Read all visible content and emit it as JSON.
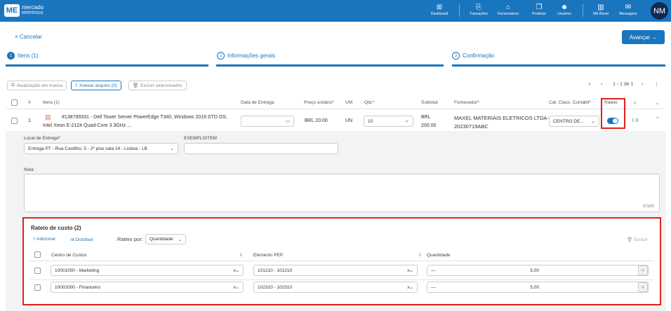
{
  "header": {
    "logo_mark": "ME",
    "logo_line1": "mercado",
    "logo_line2": "eletrônico",
    "nav": [
      {
        "label": "Dashboard",
        "icon": "grid-icon"
      },
      {
        "label": "Transações",
        "icon": "document-arrow-icon"
      },
      {
        "label": "Fornecedores",
        "icon": "store-icon"
      },
      {
        "label": "Produtos",
        "icon": "box-icon"
      },
      {
        "label": "Usuários",
        "icon": "users-icon"
      },
      {
        "label": "ME Boost",
        "icon": "chart-icon"
      },
      {
        "label": "Mensagens",
        "icon": "chat-icon"
      }
    ],
    "avatar": "NM"
  },
  "actions": {
    "cancel": "× Cancelar",
    "advance": "Avançar →"
  },
  "steps": [
    {
      "num": "1",
      "label": "Itens (1)"
    },
    {
      "num": "2",
      "label": "Informações gerais"
    },
    {
      "num": "3",
      "label": "Confirmação"
    }
  ],
  "toolbar": {
    "bulk_update": "Atualização em massa",
    "attach": "Anexar arquivo (0)",
    "delete_selected": "Excluir selecionados",
    "page_info": "1 - 1 de 1"
  },
  "table": {
    "headers": {
      "num": "#",
      "items": "Itens (1)",
      "delivery_date": "Data de Entrega",
      "unit_price": "Preço unitário*",
      "um": "UM",
      "qty": "Qtd.*",
      "subtotal": "Subtotal",
      "supplier": "Fornecedor*",
      "account_class": "Cat. Class. Contábil*",
      "rateio": "Rateio"
    },
    "row": {
      "num": "1",
      "description_line1": "#138799331 - Dell Tower Server PowerEdge T340, Windows 2019 STD OS,",
      "description_line2": "Intel Xeon E-2124 Quad-Core 3.3GHz ...",
      "price": "BRL 20.00",
      "um": "UN",
      "qty": "10",
      "subtotal_line1": "BRL",
      "subtotal_line2": "200.00",
      "supplier_line1": "MAXEL MATERIAIS ELETRICOS LTDA-",
      "supplier_line2": "20230719ABC",
      "account_class": "CENTRO DE...",
      "attachments": "0"
    }
  },
  "details": {
    "delivery_label": "Local de Entrega*",
    "delivery_value": "Entrega PT - Rua Castilho, 5 - 2º piso sala 24 - Lisboa - LB",
    "example_label": "EXEMPLOITEM",
    "note_label": "Nota",
    "note_counter": "0/180"
  },
  "rateio": {
    "title": "Rateio de custo (2)",
    "add": "+ Adicionar",
    "distribute": "Distribuir",
    "by_label": "Rateio por:",
    "by_value": "Quantidade",
    "delete": "Excluir",
    "col_cost_center": "Centro de Custos",
    "col_pep": "Elemento PEP",
    "col_qty": "Quantidade",
    "rows": [
      {
        "cost_center": "10001000 - Marketing",
        "pep": "101210 - 101210",
        "qty": "5,00"
      },
      {
        "cost_center": "10002000 - Financeiro",
        "pep": "102310 - 102310",
        "qty": "5,00"
      }
    ]
  },
  "colors": {
    "primary": "#1a75bf",
    "highlight": "#e0201c",
    "success": "#2ecc71"
  }
}
